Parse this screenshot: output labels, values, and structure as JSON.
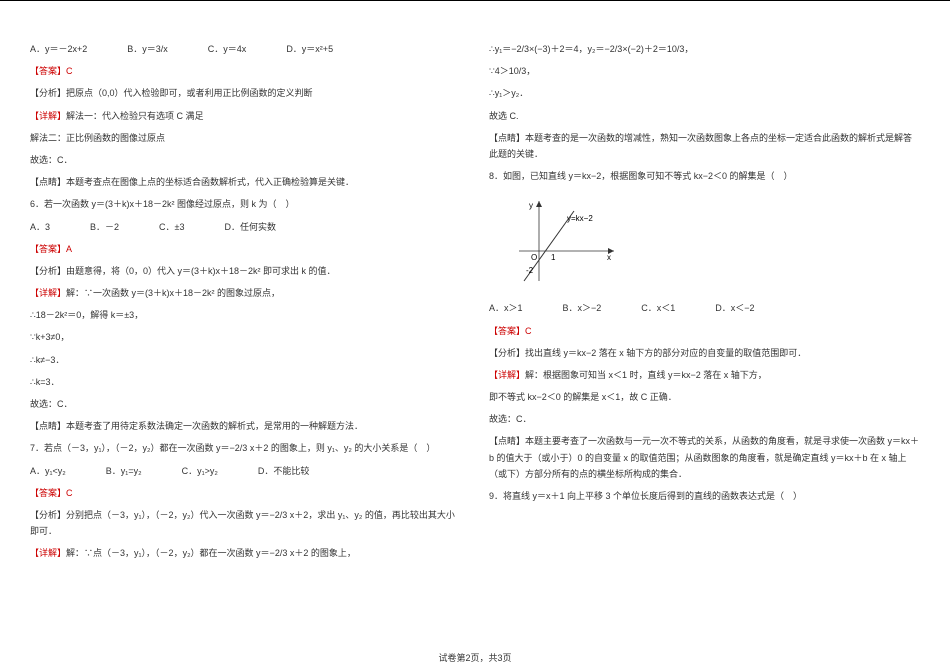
{
  "left": {
    "q5_options": {
      "A": "A．y＝－2x+2",
      "B": "B．y＝3/x",
      "C": "C．y＝4x",
      "D": "D．y＝x²+5"
    },
    "ans5_label": "【答案】C",
    "an5_label": "【分析】把原点（0,0）代入检验即可，或者利用正比例函数的定义判断",
    "det5_label_red": "【详解】",
    "det5_text": "解法一：代入检验只有选项 C 满足",
    "det5_2": "解法二：正比例函数的图像过原点",
    "det5_3": "故选：C．",
    "tip5": "【点睛】本题考查点在图像上点的坐标适合函数解析式，代入正确检验算是关键．",
    "q6": "6．若一次函数 y＝(3＋k)x＋18－2k² 图像经过原点，则 k 为（　）",
    "q6_options": {
      "A": "A．3",
      "B": "B．－2",
      "C": "C．±3",
      "D": "D．任何实数"
    },
    "ans6_label": "【答案】A",
    "an6_label": "【分析】由题意得，将（0，0）代入 y＝(3＋k)x＋18－2k² 即可求出 k 的值．",
    "det6_red": "【详解】",
    "det6_text": "解：∵一次函数 y＝(3＋k)x＋18－2k² 的图象过原点，",
    "det6_2": "∴18－2k²＝0，解得 k＝±3，",
    "det6_3": "∵k+3≠0，",
    "det6_4": "∴k≠−3．",
    "det6_5": "∴k=3．",
    "det6_6": "故选：C．",
    "tip6": "【点睛】本题考查了用待定系数法确定一次函数的解析式，是常用的一种解题方法．",
    "q7": "7．若点（－3，y₁），（－2，y₂）都在一次函数 y＝−2/3 x＋2 的图象上，则 y₁、y₂ 的大小关系是（　）",
    "q7_options": {
      "A": "A．y₁<y₂",
      "B": "B．y₁=y₂",
      "C": "C．y₁>y₂",
      "D": "D．不能比较"
    },
    "ans7_label": "【答案】C",
    "an7_label": "【分析】分别把点（－3，y₁），（－2，y₂）代入一次函数 y＝−2/3 x＋2，求出 y₁、y₂ 的值，再比较出其大小即可．",
    "det7_red": "【详解】",
    "det7_text": "解：∵点（－3，y₁），（－2，y₂）都在一次函数 y＝−2/3 x＋2 的图象上，"
  },
  "right": {
    "calc1": "∴y₁＝−2/3×(−3)＋2＝4，y₂＝−2/3×(−2)＋2＝10/3，",
    "calc2": "∵4＞10/3，",
    "calc3": "∴y₁＞y₂．",
    "sel7": "故选 C.",
    "tip7": "【点睛】本题考查的是一次函数的增减性，熟知一次函数图象上各点的坐标一定适合此函数的解析式是解答此题的关键．",
    "q8": "8．如图，已知直线 y＝kx−2，根据图象可知不等式 kx−2＜0 的解集是（　）",
    "graph_label1": "y=kx−2",
    "graph_O": "O",
    "graph_neg2": "-2",
    "graph_x": "x",
    "graph_y": "y",
    "graph_1": "1",
    "q8_options": {
      "A": "A．x＞1",
      "B": "B．x＞−2",
      "C": "C．x＜1",
      "D": "D．x＜−2"
    },
    "ans8_label": "【答案】C",
    "an8_label": "【分析】找出直线 y＝kx−2 落在 x 轴下方的部分对应的自变量的取值范围即可．",
    "det8_red": "【详解】",
    "det8_text": "解：根据图象可知当 x＜1 时，直线 y＝kx−2 落在 x 轴下方，",
    "det8_2": "即不等式 kx−2＜0 的解集是 x＜1，故 C 正确．",
    "det8_3": "故选：C．",
    "tip8": "【点睛】本题主要考查了一次函数与一元一次不等式的关系，从函数的角度看，就是寻求使一次函数 y＝kx＋b 的值大于（或小于）0 的自变量 x 的取值范围；从函数图象的角度看，就是确定直线 y＝kx＋b 在 x 轴上（或下）方部分所有的点的横坐标所构成的集合．",
    "q9": "9．将直线 y＝x＋1 向上平移 3 个单位长度后得到的直线的函数表达式是（　）"
  },
  "footer": "试卷第2页，共3页"
}
